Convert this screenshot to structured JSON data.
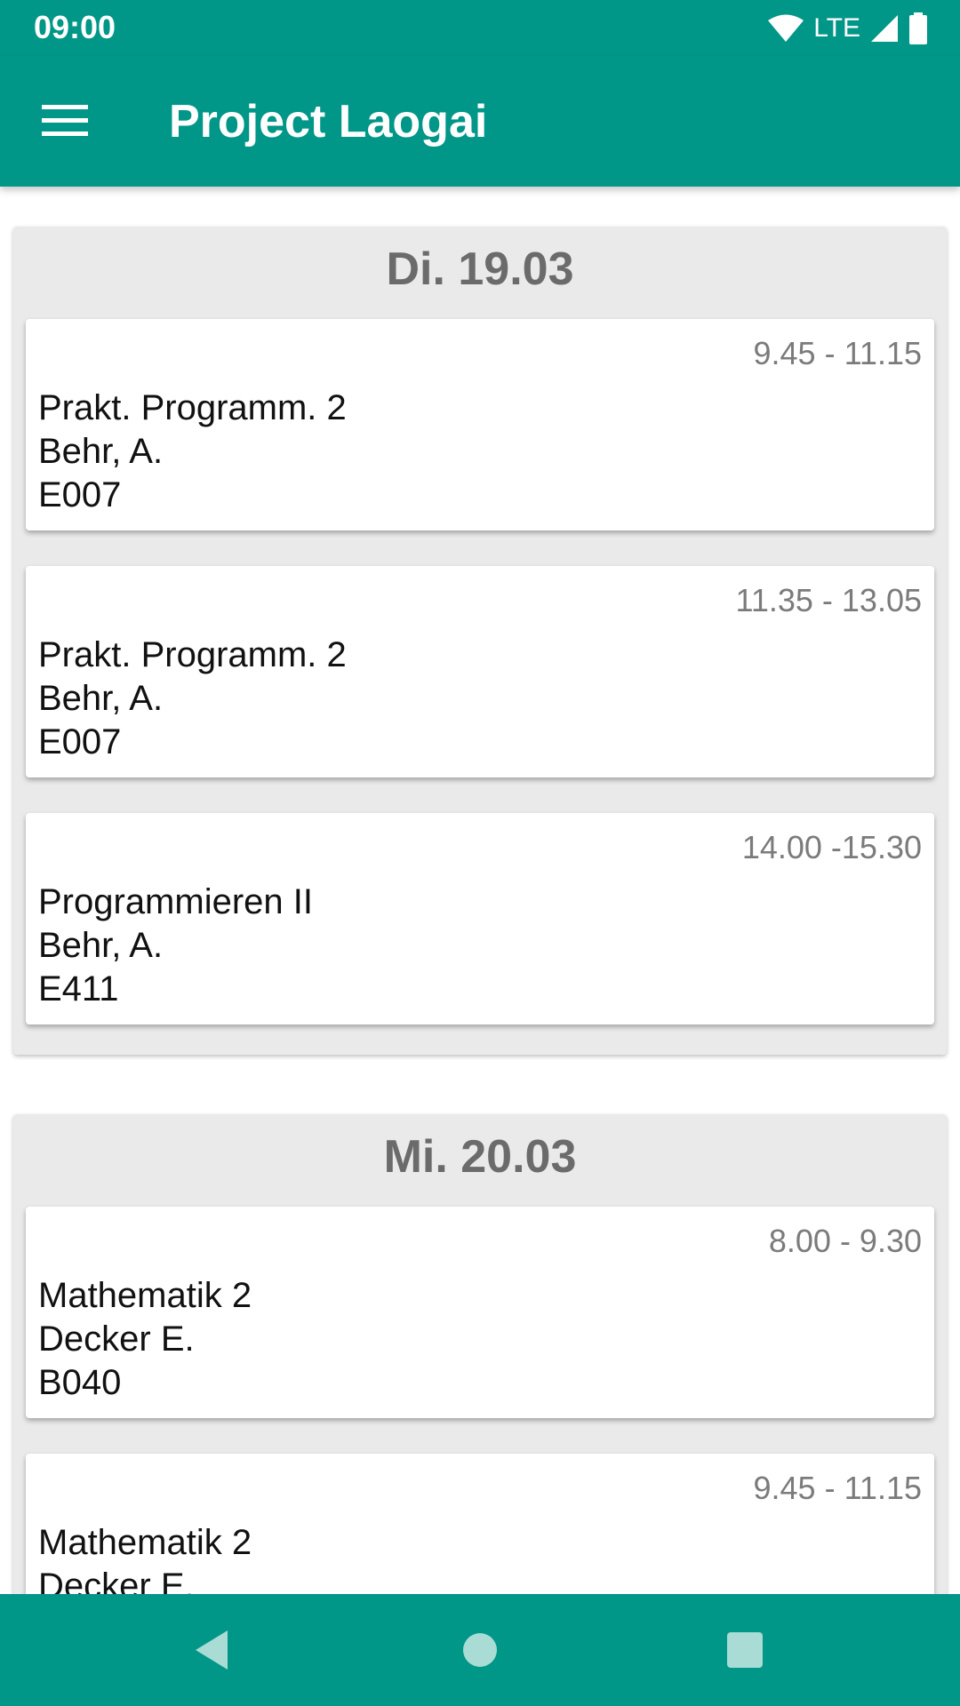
{
  "status_bar": {
    "time": "09:00",
    "network_label": "LTE",
    "icons": [
      "wifi-icon",
      "cell-signal-icon",
      "battery-icon"
    ]
  },
  "app_bar": {
    "title": "Project Laogai",
    "menu_icon": "hamburger-menu-icon"
  },
  "colors": {
    "primary": "#009688",
    "day_card_bg": "#ebeaea",
    "day_header_text": "#6b6b6b",
    "time_text": "#7b7b7b"
  },
  "days": [
    {
      "label": "Di. 19.03",
      "lessons": [
        {
          "time": "9.45 - 11.15",
          "subject": "Prakt. Programm. 2",
          "teacher": "Behr, A.",
          "room": "E007"
        },
        {
          "time": "11.35 - 13.05",
          "subject": "Prakt. Programm. 2",
          "teacher": "Behr, A.",
          "room": "E007"
        },
        {
          "time": "14.00 -15.30",
          "subject": "Programmieren II",
          "teacher": "Behr, A.",
          "room": "E411"
        }
      ]
    },
    {
      "label": "Mi. 20.03",
      "lessons": [
        {
          "time": "8.00 - 9.30",
          "subject": "Mathematik 2",
          "teacher": "Decker E.",
          "room": "B040"
        },
        {
          "time": "9.45 - 11.15",
          "subject": "Mathematik 2",
          "teacher": "Decker E.",
          "room": ""
        }
      ]
    }
  ],
  "nav_bar": {
    "icons": [
      "back-icon",
      "home-icon",
      "recents-icon"
    ]
  }
}
